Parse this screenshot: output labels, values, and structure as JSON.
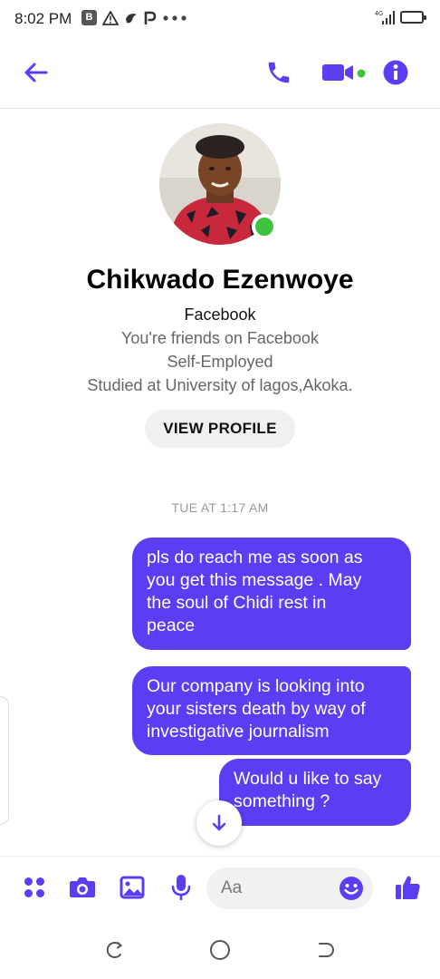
{
  "status_bar": {
    "time": "8:02 PM",
    "network": "4G"
  },
  "header": {
    "back_icon": "arrow-left-icon",
    "call_icon": "phone-icon",
    "video_icon": "video-camera-icon",
    "info_icon": "info-icon"
  },
  "profile": {
    "name": "Chikwado Ezenwoye",
    "platform": "Facebook",
    "friends_text": "You're friends on Facebook",
    "work": "Self-Employed",
    "education": "Studied at University of lagos,Akoka.",
    "view_profile_label": "VIEW PROFILE"
  },
  "conversation": {
    "timestamp": "TUE AT 1:17 AM",
    "messages": [
      {
        "lines": [
          "pls do reach me as soon as",
          "you get this message . May",
          "the soul of Chidi rest in",
          "peace"
        ]
      },
      {
        "lines": [
          "Our company is looking into",
          "your sisters death by way of",
          "investigative journalism"
        ]
      },
      {
        "lines": [
          "Would u like to say",
          "something ?"
        ]
      }
    ]
  },
  "composer": {
    "placeholder": "Aa"
  },
  "colors": {
    "accent": "#5a3ef4",
    "online": "#3ec33e"
  }
}
